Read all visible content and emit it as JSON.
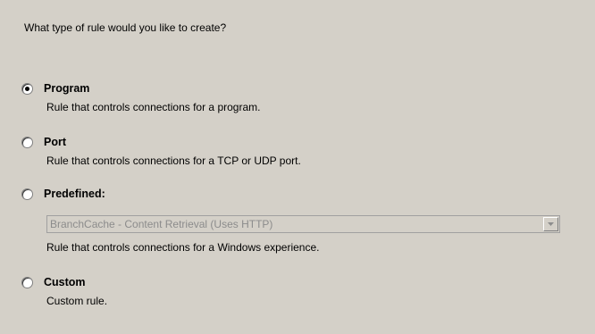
{
  "question": "What type of rule would you like to create?",
  "options": [
    {
      "label": "Program",
      "description": "Rule that controls connections for a program.",
      "selected": true
    },
    {
      "label": "Port",
      "description": "Rule that controls connections for a TCP or UDP port.",
      "selected": false
    },
    {
      "label": "Predefined:",
      "description": "Rule that controls connections for a Windows experience.",
      "selected": false
    },
    {
      "label": "Custom",
      "description": "Custom rule.",
      "selected": false
    }
  ],
  "predefined_dropdown": {
    "value": "BranchCache - Content Retrieval (Uses HTTP)",
    "enabled": false,
    "icon": "chevron-down-icon"
  },
  "colors": {
    "background": "#d4d0c8",
    "disabled_text": "#8c8c8c"
  }
}
